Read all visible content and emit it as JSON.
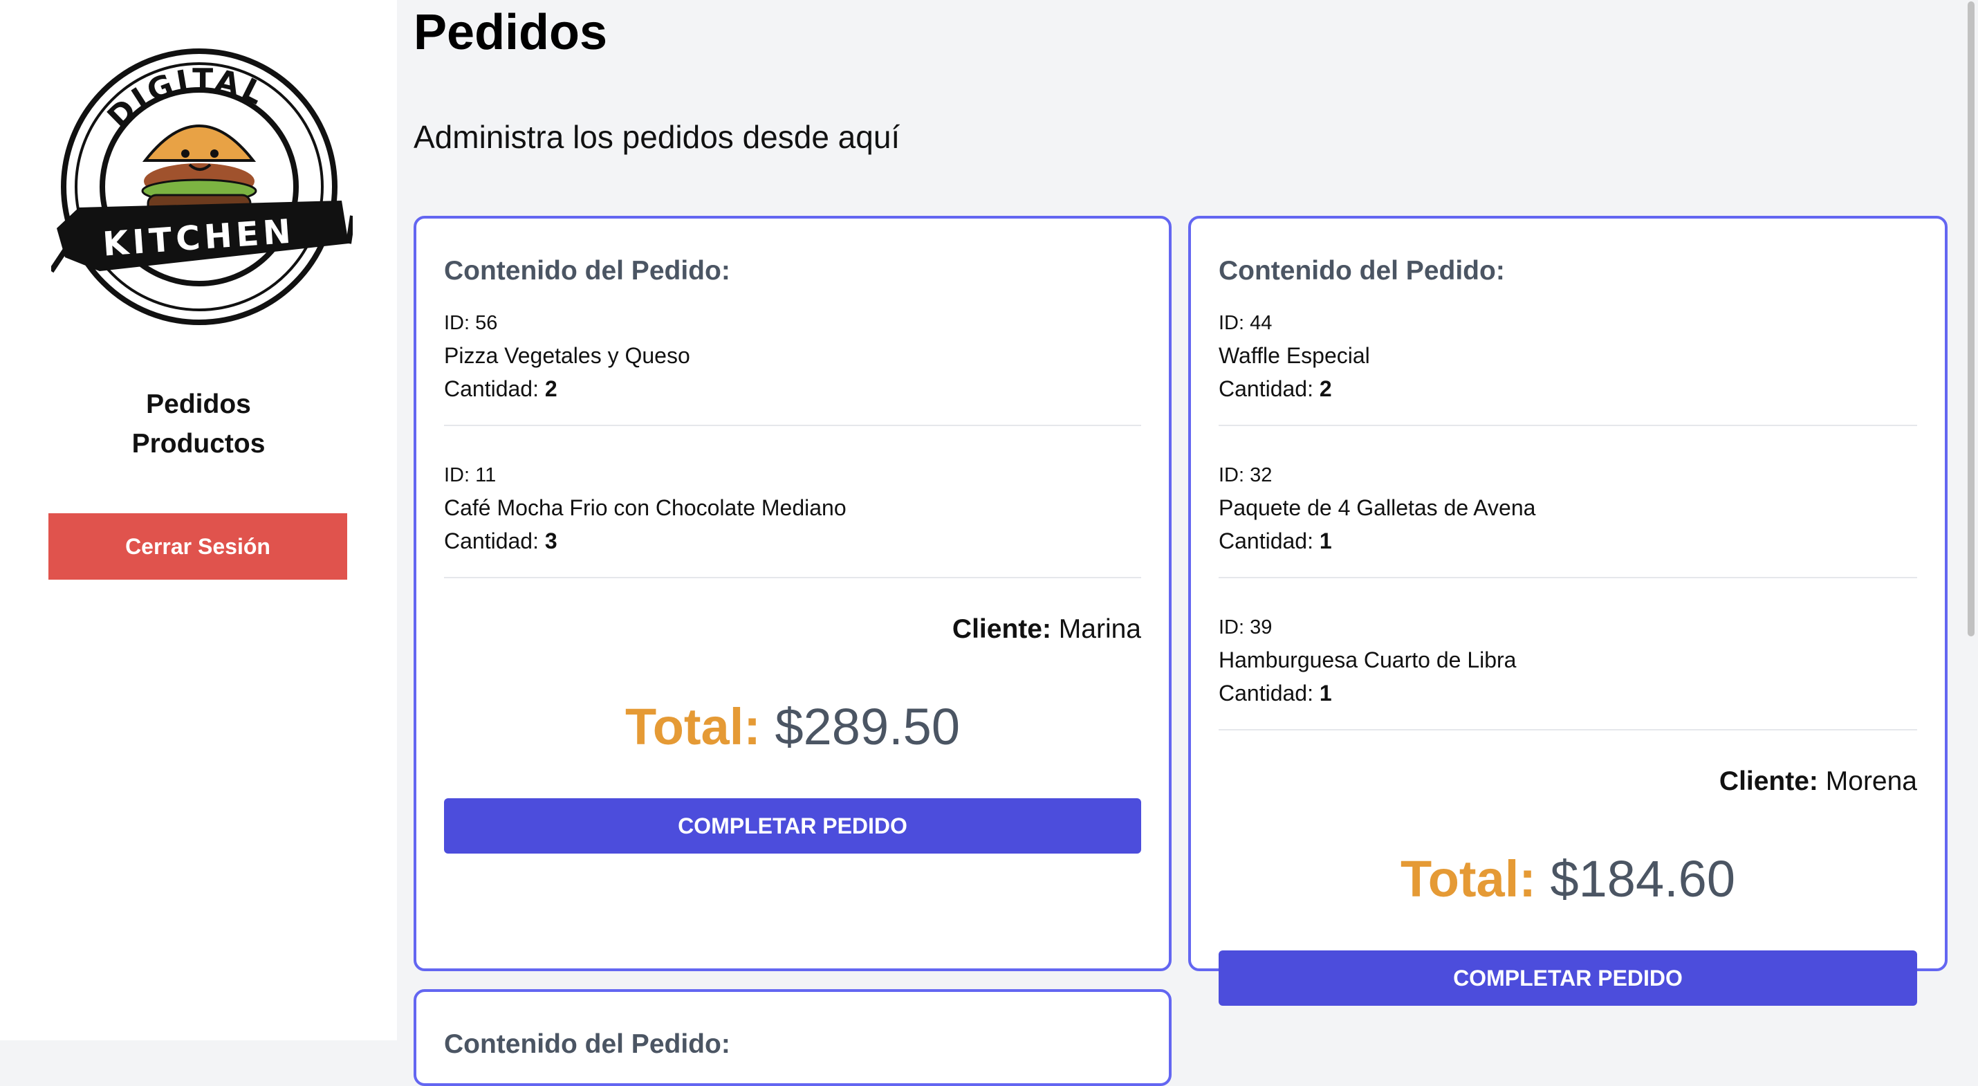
{
  "sidebar": {
    "logo": {
      "top_text": "DIGITAL",
      "bottom_text": "KITCHEN"
    },
    "nav": [
      {
        "label": "Pedidos"
      },
      {
        "label": "Productos"
      }
    ],
    "logout_label": "Cerrar Sesión"
  },
  "main": {
    "title": "Pedidos",
    "subtitle": "Administra los pedidos desde aquí",
    "orders": [
      {
        "heading": "Contenido del Pedido:",
        "items": [
          {
            "id_label": "ID: 56",
            "name": "Pizza Vegetales y Queso",
            "qty_label": "Cantidad: ",
            "qty": "2"
          },
          {
            "id_label": "ID: 11",
            "name": "Café Mocha Frio con Chocolate Mediano",
            "qty_label": "Cantidad: ",
            "qty": "3"
          }
        ],
        "client_label": "Cliente:",
        "client_name": "Marina",
        "total_label": "Total:",
        "total_value": "$289.50",
        "button_label": "COMPLETAR PEDIDO"
      },
      {
        "heading": "Contenido del Pedido:",
        "items": [
          {
            "id_label": "ID: 44",
            "name": "Waffle Especial",
            "qty_label": "Cantidad: ",
            "qty": "2"
          },
          {
            "id_label": "ID: 32",
            "name": "Paquete de 4 Galletas de Avena",
            "qty_label": "Cantidad: ",
            "qty": "1"
          },
          {
            "id_label": "ID: 39",
            "name": "Hamburguesa Cuarto de Libra",
            "qty_label": "Cantidad: ",
            "qty": "1"
          }
        ],
        "client_label": "Cliente:",
        "client_name": "Morena",
        "total_label": "Total:",
        "total_value": "$184.60",
        "button_label": "COMPLETAR PEDIDO"
      },
      {
        "heading": "Contenido del Pedido:"
      }
    ]
  },
  "colors": {
    "accent": "#4c4ddc",
    "card_border": "#6366f1",
    "logout": "#e0534d",
    "total_label": "#e59a35"
  }
}
